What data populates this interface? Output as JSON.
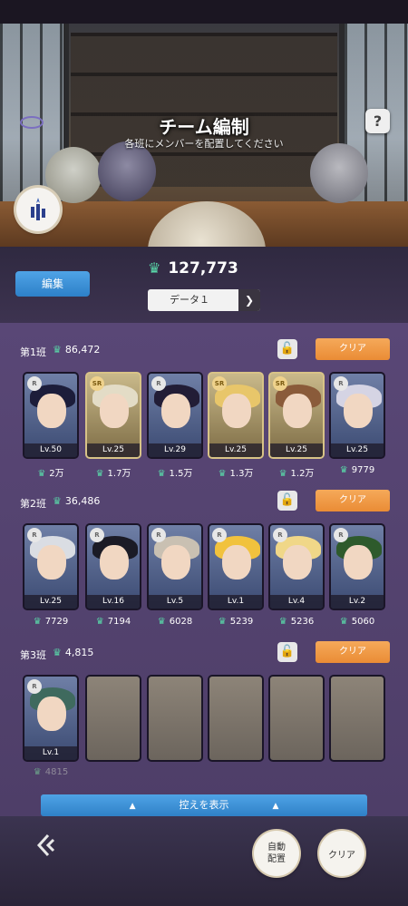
{
  "header": {
    "title": "チーム編制",
    "subtitle": "各班にメンバーを配置してください",
    "help_label": "?",
    "logo_icon": "team-logo-icon"
  },
  "toolbar": {
    "edit_label": "編集",
    "total_power": "127,773",
    "data_select": "データ１"
  },
  "groups": [
    {
      "label": "第1班",
      "power": "86,472",
      "clear_label": "クリア",
      "cards": [
        {
          "rank": "R",
          "level": "Lv.50",
          "power": "2万"
        },
        {
          "rank": "SR",
          "level": "Lv.25",
          "power": "1.7万"
        },
        {
          "rank": "R",
          "level": "Lv.29",
          "power": "1.5万"
        },
        {
          "rank": "SR",
          "level": "Lv.25",
          "power": "1.3万"
        },
        {
          "rank": "SR",
          "level": "Lv.25",
          "power": "1.2万"
        },
        {
          "rank": "R",
          "level": "Lv.25",
          "power": "9779"
        }
      ]
    },
    {
      "label": "第2班",
      "power": "36,486",
      "clear_label": "クリア",
      "cards": [
        {
          "rank": "R",
          "level": "Lv.25",
          "power": "7729"
        },
        {
          "rank": "R",
          "level": "Lv.16",
          "power": "7194"
        },
        {
          "rank": "R",
          "level": "Lv.5",
          "power": "6028"
        },
        {
          "rank": "R",
          "level": "Lv.1",
          "power": "5239"
        },
        {
          "rank": "R",
          "level": "Lv.4",
          "power": "5236"
        },
        {
          "rank": "R",
          "level": "Lv.2",
          "power": "5060"
        }
      ]
    },
    {
      "label": "第3班",
      "power": "4,815",
      "clear_label": "クリア",
      "cards": [
        {
          "rank": "R",
          "level": "Lv.1",
          "power": "4815"
        }
      ]
    }
  ],
  "reserve_label": "控えを表示",
  "footer": {
    "auto_label": "自動\n配置",
    "clear_label": "クリア"
  },
  "colors": {
    "accent_orange": "#ea8c35",
    "accent_blue": "#2d80c8",
    "power_green": "#59d6a8"
  }
}
